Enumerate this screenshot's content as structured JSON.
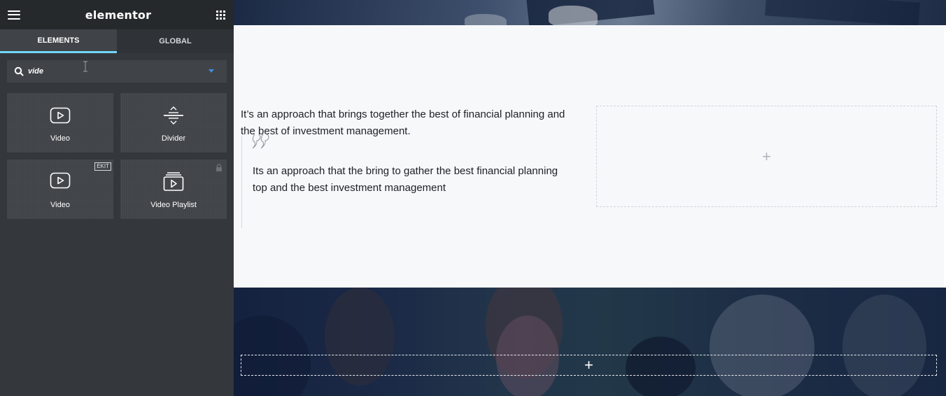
{
  "sidebar": {
    "brand": "elementor",
    "tabs": [
      {
        "label": "ELEMENTS",
        "active": true
      },
      {
        "label": "GLOBAL",
        "active": false
      }
    ],
    "search": {
      "value": "vide"
    },
    "widgets": [
      {
        "label": "Video",
        "icon": "video-play-icon"
      },
      {
        "label": "Divider",
        "icon": "divider-icon"
      },
      {
        "label": "Video",
        "icon": "video-play-icon",
        "badge": "EKIT"
      },
      {
        "label": "Video Playlist",
        "icon": "video-playlist-icon",
        "locked": true
      }
    ]
  },
  "canvas": {
    "paragraph": "It’s an approach that brings together the best of financial planning and the best of investment management.",
    "quote": "Its an approach that the bring to gather the best financial planning top and the best investment management",
    "add_plus": "+",
    "section_plus": "+"
  },
  "colors": {
    "accent_tab": "#71d7f7",
    "panel_bg": "#34383c",
    "topbar_bg": "#26292c"
  }
}
